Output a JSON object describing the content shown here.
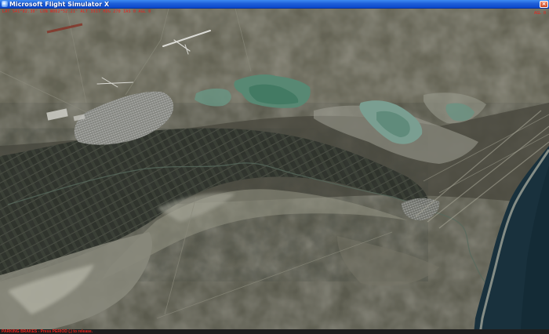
{
  "window": {
    "title": "Microsoft Flight Simulator X"
  },
  "hud": {
    "status_line": "LAT S41°02.30'  LON W062°52.21'  ALT 3917  HDG 270  IAS 0  AGL 0",
    "status_right": "AGL 0"
  },
  "message": {
    "text": "PARKING BRAKES - Press PERIOD (.) to release."
  },
  "colors": {
    "titlebar": "#1f5fd9",
    "hud_text": "#e8231d",
    "sea": "#16303e",
    "desert": "#6b6a5c",
    "lagoon": "#5b8f79"
  },
  "icons": {
    "app": "fsx-app-icon",
    "close": "close-icon"
  }
}
